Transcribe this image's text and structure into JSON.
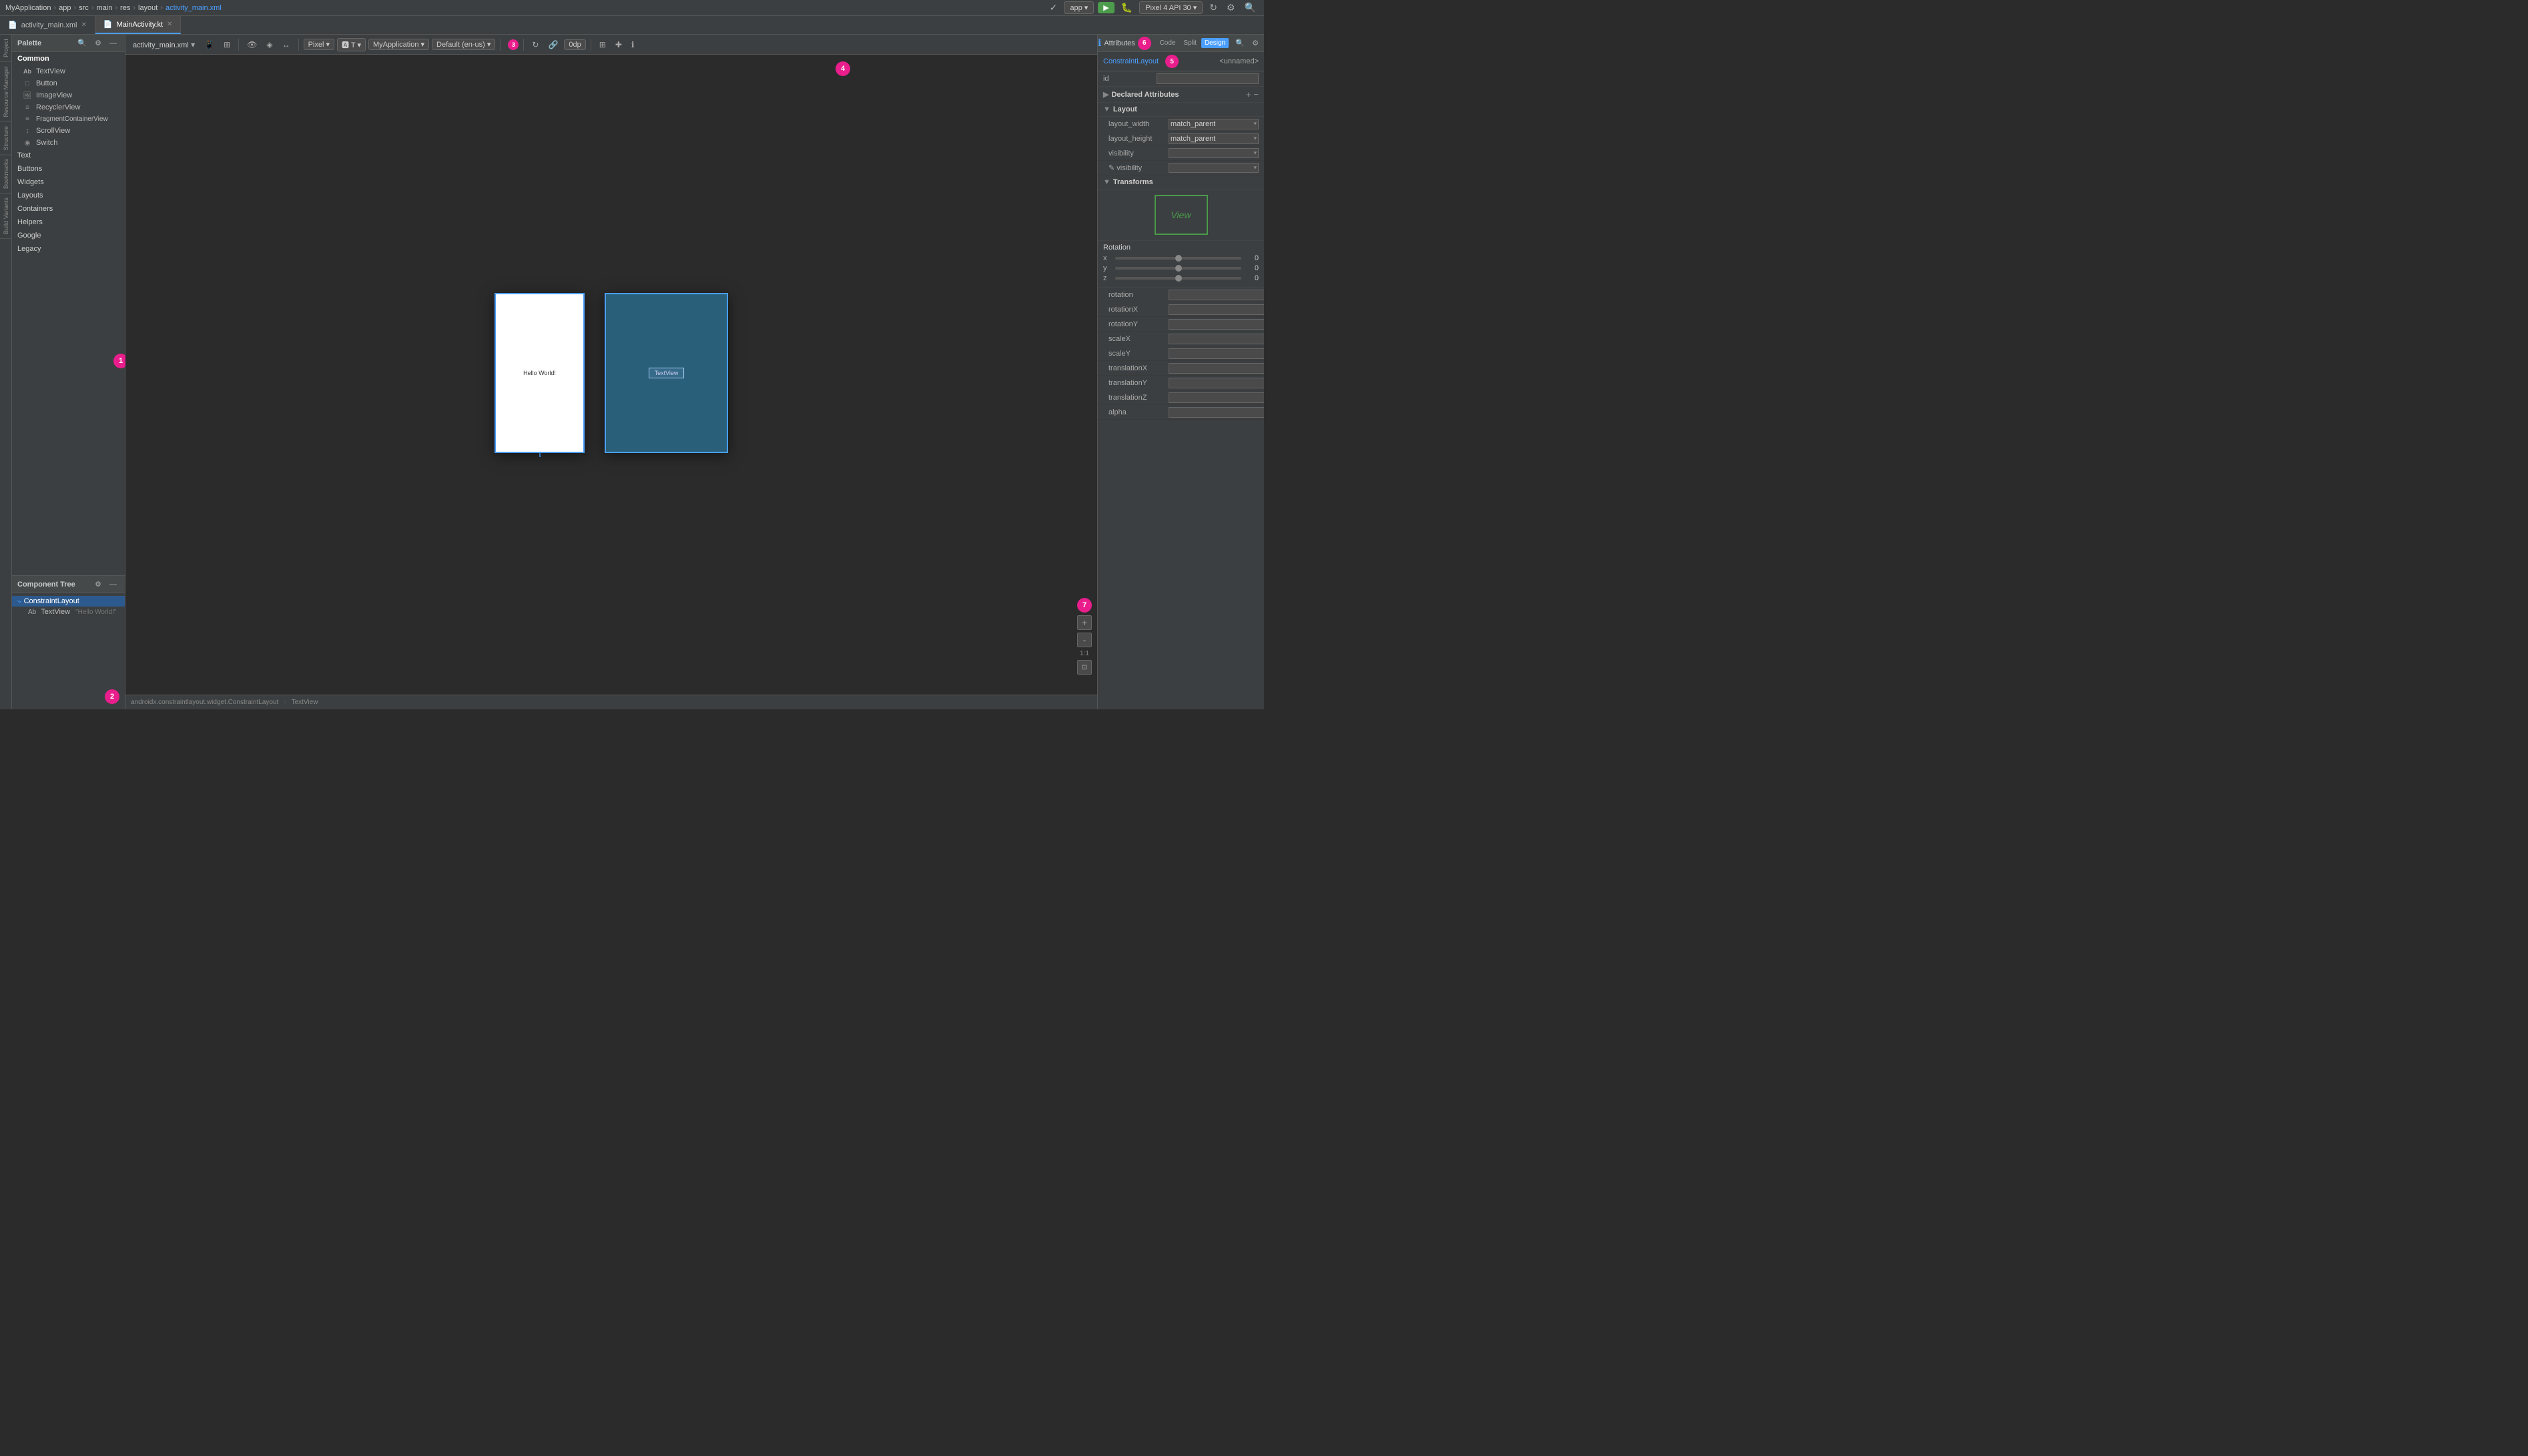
{
  "titlebar": {
    "breadcrumb": [
      "MyApplication",
      "app",
      "src",
      "main",
      "res",
      "layout",
      "activity_main.xml"
    ],
    "app_label": "app",
    "device_label": "Pixel 4 API 30",
    "run_icon": "▶",
    "search_icon": "🔍"
  },
  "tabs": [
    {
      "id": "activity_main",
      "label": "activity_main.xml",
      "icon": "📄",
      "active": false
    },
    {
      "id": "main_activity",
      "label": "MainActivity.kt",
      "icon": "📄",
      "active": true
    }
  ],
  "palette": {
    "header": "Palette",
    "search_placeholder": "Search",
    "categories": [
      {
        "id": "common",
        "label": "Common",
        "active": true
      },
      {
        "id": "text",
        "label": "Text"
      },
      {
        "id": "buttons",
        "label": "Buttons"
      },
      {
        "id": "widgets",
        "label": "Widgets"
      },
      {
        "id": "layouts",
        "label": "Layouts"
      },
      {
        "id": "containers",
        "label": "Containers"
      },
      {
        "id": "helpers",
        "label": "Helpers"
      },
      {
        "id": "google",
        "label": "Google"
      },
      {
        "id": "legacy",
        "label": "Legacy"
      }
    ],
    "items": [
      {
        "id": "textview",
        "label": "TextView",
        "icon": "Ab"
      },
      {
        "id": "button",
        "label": "Button",
        "icon": "□"
      },
      {
        "id": "imageview",
        "label": "ImageView",
        "icon": "🖼"
      },
      {
        "id": "recyclerview",
        "label": "RecyclerView",
        "icon": "≡"
      },
      {
        "id": "fragmentcontainerview",
        "label": "FragmentContainerView",
        "icon": "≡"
      },
      {
        "id": "scrollview",
        "label": "ScrollView",
        "icon": "↕"
      },
      {
        "id": "switch",
        "label": "Switch",
        "icon": "◉"
      }
    ],
    "badge": "1"
  },
  "component_tree": {
    "header": "Component Tree",
    "items": [
      {
        "id": "constraint_layout",
        "label": "ConstraintLayout",
        "indent": 0,
        "selected": true
      },
      {
        "id": "textview",
        "label": "TextView",
        "indent": 1,
        "value": "\"Hello World!\"",
        "selected": false
      }
    ],
    "badge": "2"
  },
  "toolbar": {
    "file_label": "activity_main.xml",
    "padding_label": "0dp",
    "orientation_icon": "↔",
    "zoom_icon": "🔍",
    "badge": "4"
  },
  "canvas": {
    "hello_world": "Hello World!",
    "textview_label": "TextView"
  },
  "attributes": {
    "header": "Attributes",
    "component_type": "ConstraintLayout",
    "component_name": "<unnamed>",
    "id_label": "id",
    "sections": {
      "declared_attributes": {
        "label": "Declared Attributes",
        "badge": "5",
        "expanded": true
      },
      "layout": {
        "label": "Layout",
        "expanded": true,
        "rows": [
          {
            "label": "layout_width",
            "value": "match_parent",
            "type": "dropdown"
          },
          {
            "label": "layout_height",
            "value": "match_parent",
            "type": "dropdown"
          },
          {
            "label": "visibility",
            "value": "",
            "type": "dropdown"
          },
          {
            "label": "✎ visibility",
            "value": "",
            "type": "dropdown"
          }
        ]
      },
      "transforms": {
        "label": "Transforms",
        "expanded": true
      }
    },
    "view_preview_label": "View",
    "rotation": {
      "label": "Rotation",
      "axes": [
        {
          "axis": "x",
          "value": "0"
        },
        {
          "axis": "y",
          "value": "0"
        },
        {
          "axis": "z",
          "value": "0"
        }
      ]
    },
    "transform_rows": [
      {
        "label": "rotation",
        "value": ""
      },
      {
        "label": "rotationX",
        "value": ""
      },
      {
        "label": "rotationY",
        "value": ""
      },
      {
        "label": "scaleX",
        "value": ""
      },
      {
        "label": "scaleY",
        "value": ""
      },
      {
        "label": "translationX",
        "value": ""
      },
      {
        "label": "translationY",
        "value": ""
      },
      {
        "label": "translationZ",
        "value": ""
      },
      {
        "label": "alpha",
        "value": ""
      }
    ],
    "badge_5": "5",
    "badge_6": "6"
  },
  "bottom_bar": {
    "class_path": "androidx.constraintlayout.widget.ConstraintLayout",
    "element": "TextView"
  },
  "design_tabs": [
    {
      "id": "code",
      "label": "Code",
      "icon": "</>"
    },
    {
      "id": "split",
      "label": "Split",
      "icon": "⊟"
    },
    {
      "id": "design",
      "label": "Design",
      "active": true
    }
  ],
  "zoom_controls": {
    "plus": "+",
    "minus": "-",
    "ratio": "1:1",
    "fit": "⊡",
    "badge_7": "7"
  },
  "side_tabs": {
    "resource_manager": "Resource Manager",
    "structure": "Structure",
    "bookmarks": "Bookmarks",
    "build_variants": "Build Variants"
  }
}
